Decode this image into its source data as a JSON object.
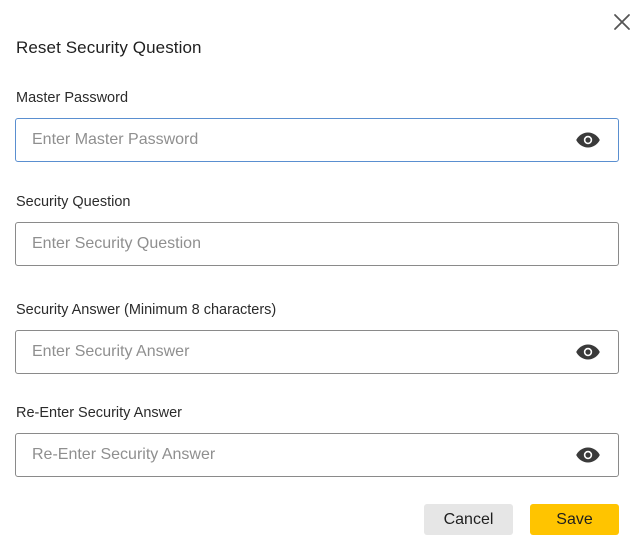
{
  "dialog": {
    "title": "Reset Security Question",
    "close_icon": "close-icon",
    "fields": {
      "master_password": {
        "label": "Master Password",
        "placeholder": "Enter Master Password",
        "value": "",
        "icon": "eye-icon"
      },
      "security_question": {
        "label": "Security Question",
        "placeholder": "Enter Security Question",
        "value": ""
      },
      "security_answer": {
        "label": "Security Answer (Minimum 8 characters)",
        "placeholder": "Enter Security Answer",
        "value": "",
        "icon": "eye-icon"
      },
      "reenter_answer": {
        "label": "Re-Enter Security Answer",
        "placeholder": "Re-Enter Security Answer",
        "value": "",
        "icon": "eye-icon"
      }
    },
    "buttons": {
      "cancel": "Cancel",
      "save": "Save"
    }
  },
  "colors": {
    "focus_border": "#5a8fd0",
    "field_border": "#8a8a8a",
    "save_bg": "#ffc400",
    "cancel_bg": "#e6e6e6",
    "icon": "#3a3a3a"
  }
}
